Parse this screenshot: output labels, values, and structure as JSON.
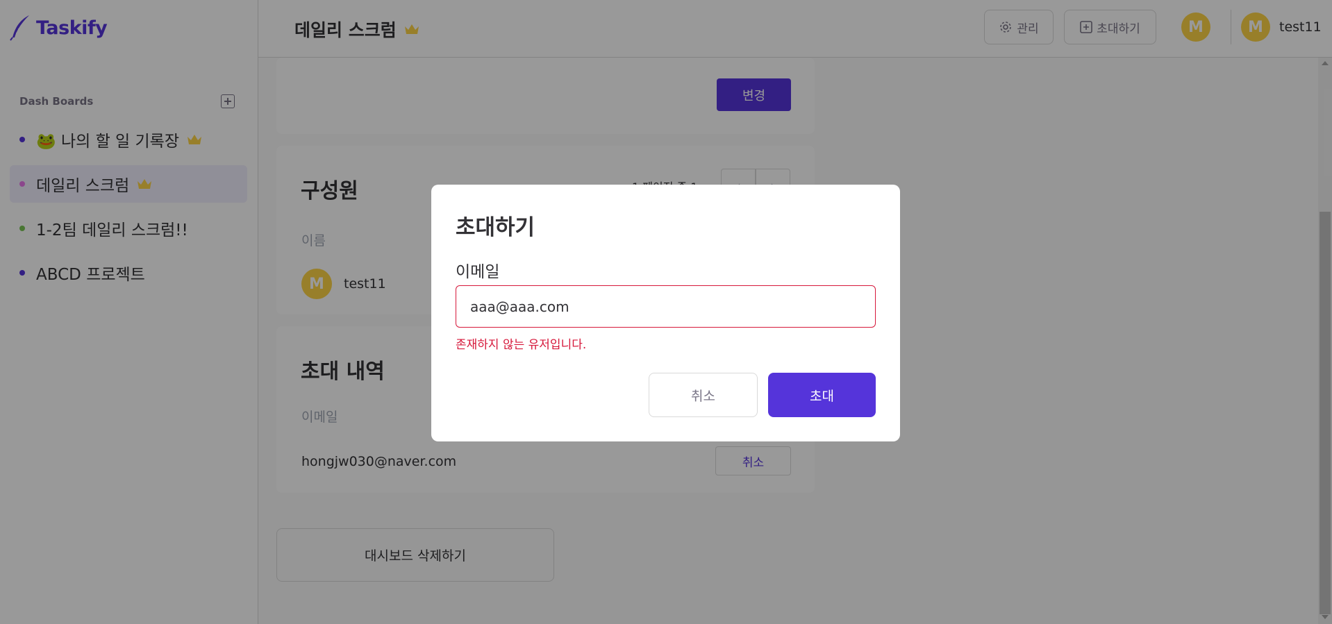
{
  "app": {
    "logo_text": "Taskify"
  },
  "sidebar": {
    "section_title": "Dash Boards",
    "boards": [
      {
        "label": "🐸 나의 할 일 기록장",
        "color": "#7ac555",
        "owner": true,
        "active": false,
        "dot_color": "#5534da"
      },
      {
        "label": "데일리 스크럼",
        "owner": true,
        "active": true,
        "dot_color": "#e876ea"
      },
      {
        "label": "1-2팀 데일리 스크럼!!",
        "owner": false,
        "active": false,
        "dot_color": "#7ac555"
      },
      {
        "label": "ABCD 프로젝트",
        "owner": false,
        "active": false,
        "dot_color": "#5534da"
      }
    ]
  },
  "header": {
    "title": "데일리 스크럼",
    "manage_label": "관리",
    "invite_label": "초대하기",
    "avatar_initial": "M",
    "user_initial": "M",
    "username": "test11"
  },
  "main": {
    "change_button": "변경",
    "members": {
      "title": "구성원",
      "pagination": "1 페이지 중 1",
      "column_label": "이름",
      "rows": [
        {
          "initial": "M",
          "name": "test11"
        }
      ]
    },
    "invitations": {
      "title": "초대 내역",
      "column_label": "이메일",
      "rows": [
        {
          "email": "hongjw030@naver.com",
          "cancel_label": "취소"
        }
      ]
    },
    "delete_button": "대시보드 삭제하기"
  },
  "modal": {
    "title": "초대하기",
    "email_label": "이메일",
    "email_value": "aaa@aaa.com",
    "error": "존재하지 않는 유저입니다.",
    "cancel_label": "취소",
    "invite_label": "초대"
  },
  "colors": {
    "accent": "#5534da",
    "error": "#d6173a",
    "avatar": "#fdd446",
    "crown": "#fdd446"
  }
}
